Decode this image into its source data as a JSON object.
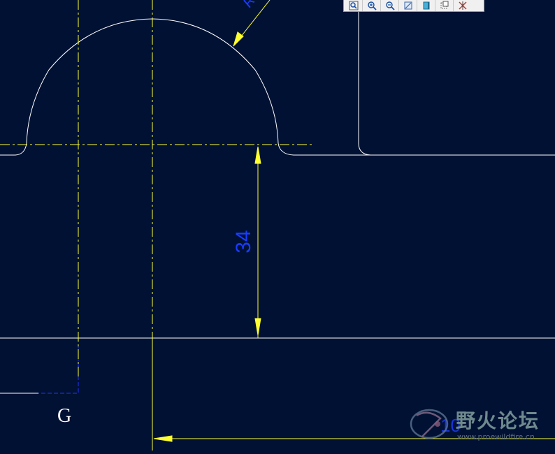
{
  "drawing": {
    "dimension_vertical": "34",
    "dimension_arc_partial": "R",
    "datum_label": "G",
    "dimension_bottom_partial": "10"
  },
  "colors": {
    "background": "#001133",
    "geometry": "#ffffff",
    "centerline": "#ffff33",
    "dimension_text": "#1a3cff",
    "toolbar": "#f0f0f0"
  },
  "toolbar": {
    "buttons": [
      {
        "icon": "zoom-box-icon"
      },
      {
        "icon": "zoom-in-icon"
      },
      {
        "icon": "zoom-out-icon"
      },
      {
        "icon": "refit-icon"
      },
      {
        "icon": "shaded-view-icon"
      },
      {
        "icon": "hidden-line-icon"
      },
      {
        "icon": "datum-display-icon"
      }
    ]
  },
  "watermark": {
    "title": "野火论坛",
    "url": "www.proewildfire.cn"
  }
}
